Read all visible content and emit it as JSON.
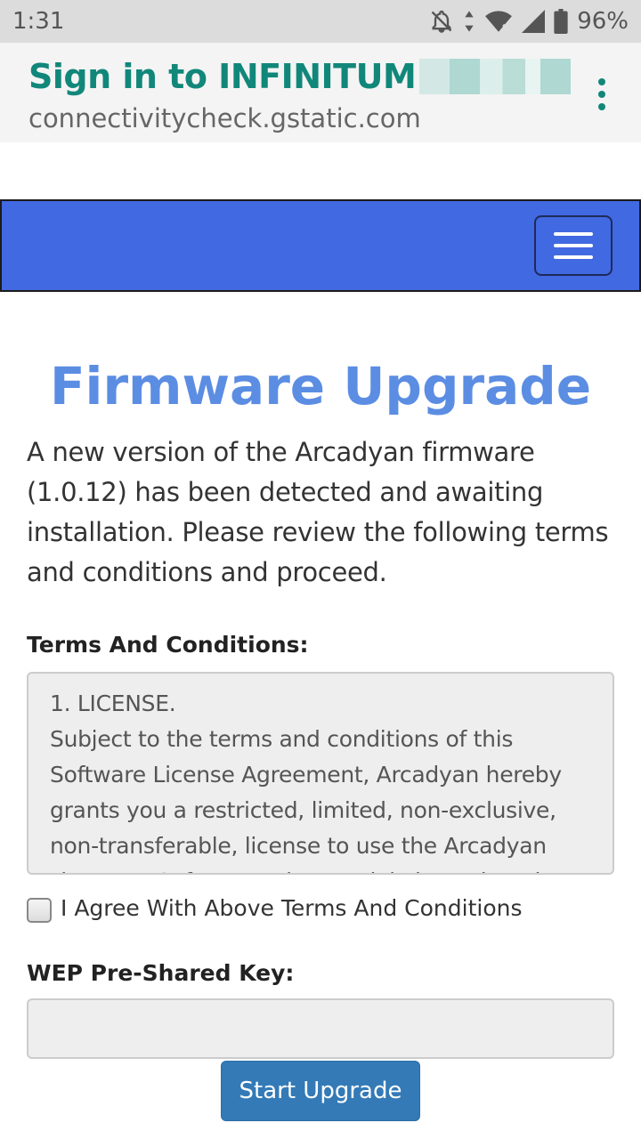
{
  "status_bar": {
    "time": "1:31",
    "battery": "96%",
    "icons": [
      "notifications-off-icon",
      "data-arrows-icon",
      "wifi-icon",
      "cell-signal-icon",
      "battery-icon"
    ]
  },
  "app_bar": {
    "title": "Sign in to INFINITUM",
    "url": "connectivitycheck.gstatic.com",
    "title_color": "#11877a"
  },
  "navbar": {
    "color": "#4169e1",
    "menu_icon": "hamburger-menu-icon"
  },
  "main": {
    "title": "Firmware Upgrade",
    "intro": "A new version of the Arcadyan firmware (1.0.12) has been detected and awaiting installation. Please review the following terms and conditions and proceed.",
    "terms_label": "Terms And Conditions:",
    "terms_text_1": "1. LICENSE.",
    "terms_text_2": "Subject to the terms and conditions of this Software License Agreement, Arcadyan hereby grants you a restricted, limited, non-exclusive, non-transferable, license to use the Arcadyan Firmware/Software/Drivers solely in conjunction",
    "agree_label": "I Agree With Above Terms And Conditions",
    "key_label": "WEP Pre-Shared Key:",
    "key_value": "",
    "button_label": "Start Upgrade"
  }
}
